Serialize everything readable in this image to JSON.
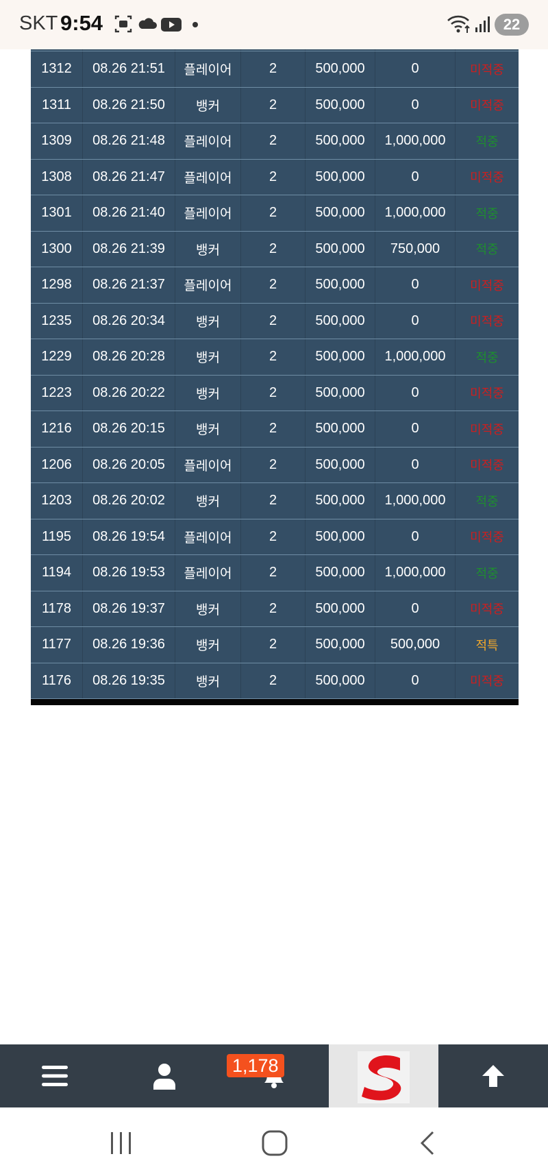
{
  "status_bar": {
    "carrier": "SKT",
    "time": "9:54",
    "battery": "22"
  },
  "table": {
    "rows": [
      {
        "id": "1312",
        "time": "08.26 21:51",
        "pick": "플레이어",
        "odds": "2",
        "bet": "500,000",
        "win": "0",
        "result": "미적중",
        "status": "miss"
      },
      {
        "id": "1311",
        "time": "08.26 21:50",
        "pick": "뱅커",
        "odds": "2",
        "bet": "500,000",
        "win": "0",
        "result": "미적중",
        "status": "miss"
      },
      {
        "id": "1309",
        "time": "08.26 21:48",
        "pick": "플레이어",
        "odds": "2",
        "bet": "500,000",
        "win": "1,000,000",
        "result": "적중",
        "status": "hit"
      },
      {
        "id": "1308",
        "time": "08.26 21:47",
        "pick": "플레이어",
        "odds": "2",
        "bet": "500,000",
        "win": "0",
        "result": "미적중",
        "status": "miss"
      },
      {
        "id": "1301",
        "time": "08.26 21:40",
        "pick": "플레이어",
        "odds": "2",
        "bet": "500,000",
        "win": "1,000,000",
        "result": "적중",
        "status": "hit"
      },
      {
        "id": "1300",
        "time": "08.26 21:39",
        "pick": "뱅커",
        "odds": "2",
        "bet": "500,000",
        "win": "750,000",
        "result": "적중",
        "status": "hit"
      },
      {
        "id": "1298",
        "time": "08.26 21:37",
        "pick": "플레이어",
        "odds": "2",
        "bet": "500,000",
        "win": "0",
        "result": "미적중",
        "status": "miss"
      },
      {
        "id": "1235",
        "time": "08.26 20:34",
        "pick": "뱅커",
        "odds": "2",
        "bet": "500,000",
        "win": "0",
        "result": "미적중",
        "status": "miss"
      },
      {
        "id": "1229",
        "time": "08.26 20:28",
        "pick": "뱅커",
        "odds": "2",
        "bet": "500,000",
        "win": "1,000,000",
        "result": "적중",
        "status": "hit"
      },
      {
        "id": "1223",
        "time": "08.26 20:22",
        "pick": "뱅커",
        "odds": "2",
        "bet": "500,000",
        "win": "0",
        "result": "미적중",
        "status": "miss"
      },
      {
        "id": "1216",
        "time": "08.26 20:15",
        "pick": "뱅커",
        "odds": "2",
        "bet": "500,000",
        "win": "0",
        "result": "미적중",
        "status": "miss"
      },
      {
        "id": "1206",
        "time": "08.26 20:05",
        "pick": "플레이어",
        "odds": "2",
        "bet": "500,000",
        "win": "0",
        "result": "미적중",
        "status": "miss"
      },
      {
        "id": "1203",
        "time": "08.26 20:02",
        "pick": "뱅커",
        "odds": "2",
        "bet": "500,000",
        "win": "1,000,000",
        "result": "적중",
        "status": "hit"
      },
      {
        "id": "1195",
        "time": "08.26 19:54",
        "pick": "플레이어",
        "odds": "2",
        "bet": "500,000",
        "win": "0",
        "result": "미적중",
        "status": "miss"
      },
      {
        "id": "1194",
        "time": "08.26 19:53",
        "pick": "플레이어",
        "odds": "2",
        "bet": "500,000",
        "win": "1,000,000",
        "result": "적중",
        "status": "hit"
      },
      {
        "id": "1178",
        "time": "08.26 19:37",
        "pick": "뱅커",
        "odds": "2",
        "bet": "500,000",
        "win": "0",
        "result": "미적중",
        "status": "miss"
      },
      {
        "id": "1177",
        "time": "08.26 19:36",
        "pick": "뱅커",
        "odds": "2",
        "bet": "500,000",
        "win": "500,000",
        "result": "적특",
        "status": "special"
      },
      {
        "id": "1176",
        "time": "08.26 19:35",
        "pick": "뱅커",
        "odds": "2",
        "bet": "500,000",
        "win": "0",
        "result": "미적중",
        "status": "miss"
      }
    ]
  },
  "bottom_nav": {
    "notification_count": "1,178",
    "logo_letter": "S"
  },
  "colors": {
    "row_bg": "#344e65",
    "miss": "#cc1f1f",
    "hit": "#1e8f2e",
    "special": "#f0a72c",
    "badge": "#f4511e",
    "nav_bg": "#343e48"
  }
}
